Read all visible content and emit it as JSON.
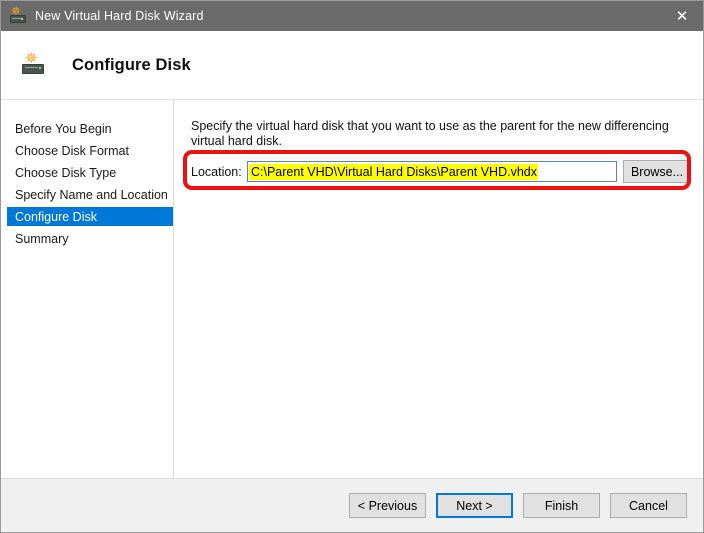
{
  "titlebar": {
    "title": "New Virtual Hard Disk Wizard",
    "icon": "virtual-hard-disk-icon",
    "close_label": "✕"
  },
  "header": {
    "title": "Configure Disk",
    "icon": "virtual-hard-disk-icon"
  },
  "sidebar": {
    "items": [
      {
        "label": "Before You Begin",
        "selected": false
      },
      {
        "label": "Choose Disk Format",
        "selected": false
      },
      {
        "label": "Choose Disk Type",
        "selected": false
      },
      {
        "label": "Specify Name and Location",
        "selected": false
      },
      {
        "label": "Configure Disk",
        "selected": true
      },
      {
        "label": "Summary",
        "selected": false
      }
    ],
    "selected_index": 4,
    "selection_color": "#0078d7"
  },
  "pane": {
    "description": "Specify the virtual hard disk that you want to use as the parent for the new differencing virtual hard disk.",
    "location_label": "Location:",
    "location_value": "C:\\Parent VHD\\Virtual Hard Disks\\Parent VHD.vhdx",
    "location_highlight_color": "#ffff00",
    "browse_label": "Browse..."
  },
  "annotation": {
    "highlight_box_color": "#ee1111"
  },
  "footer": {
    "buttons": [
      {
        "label": "< Previous",
        "default": false
      },
      {
        "label": "Next >",
        "default": true
      },
      {
        "label": "Finish",
        "default": false
      },
      {
        "label": "Cancel",
        "default": false
      }
    ]
  }
}
